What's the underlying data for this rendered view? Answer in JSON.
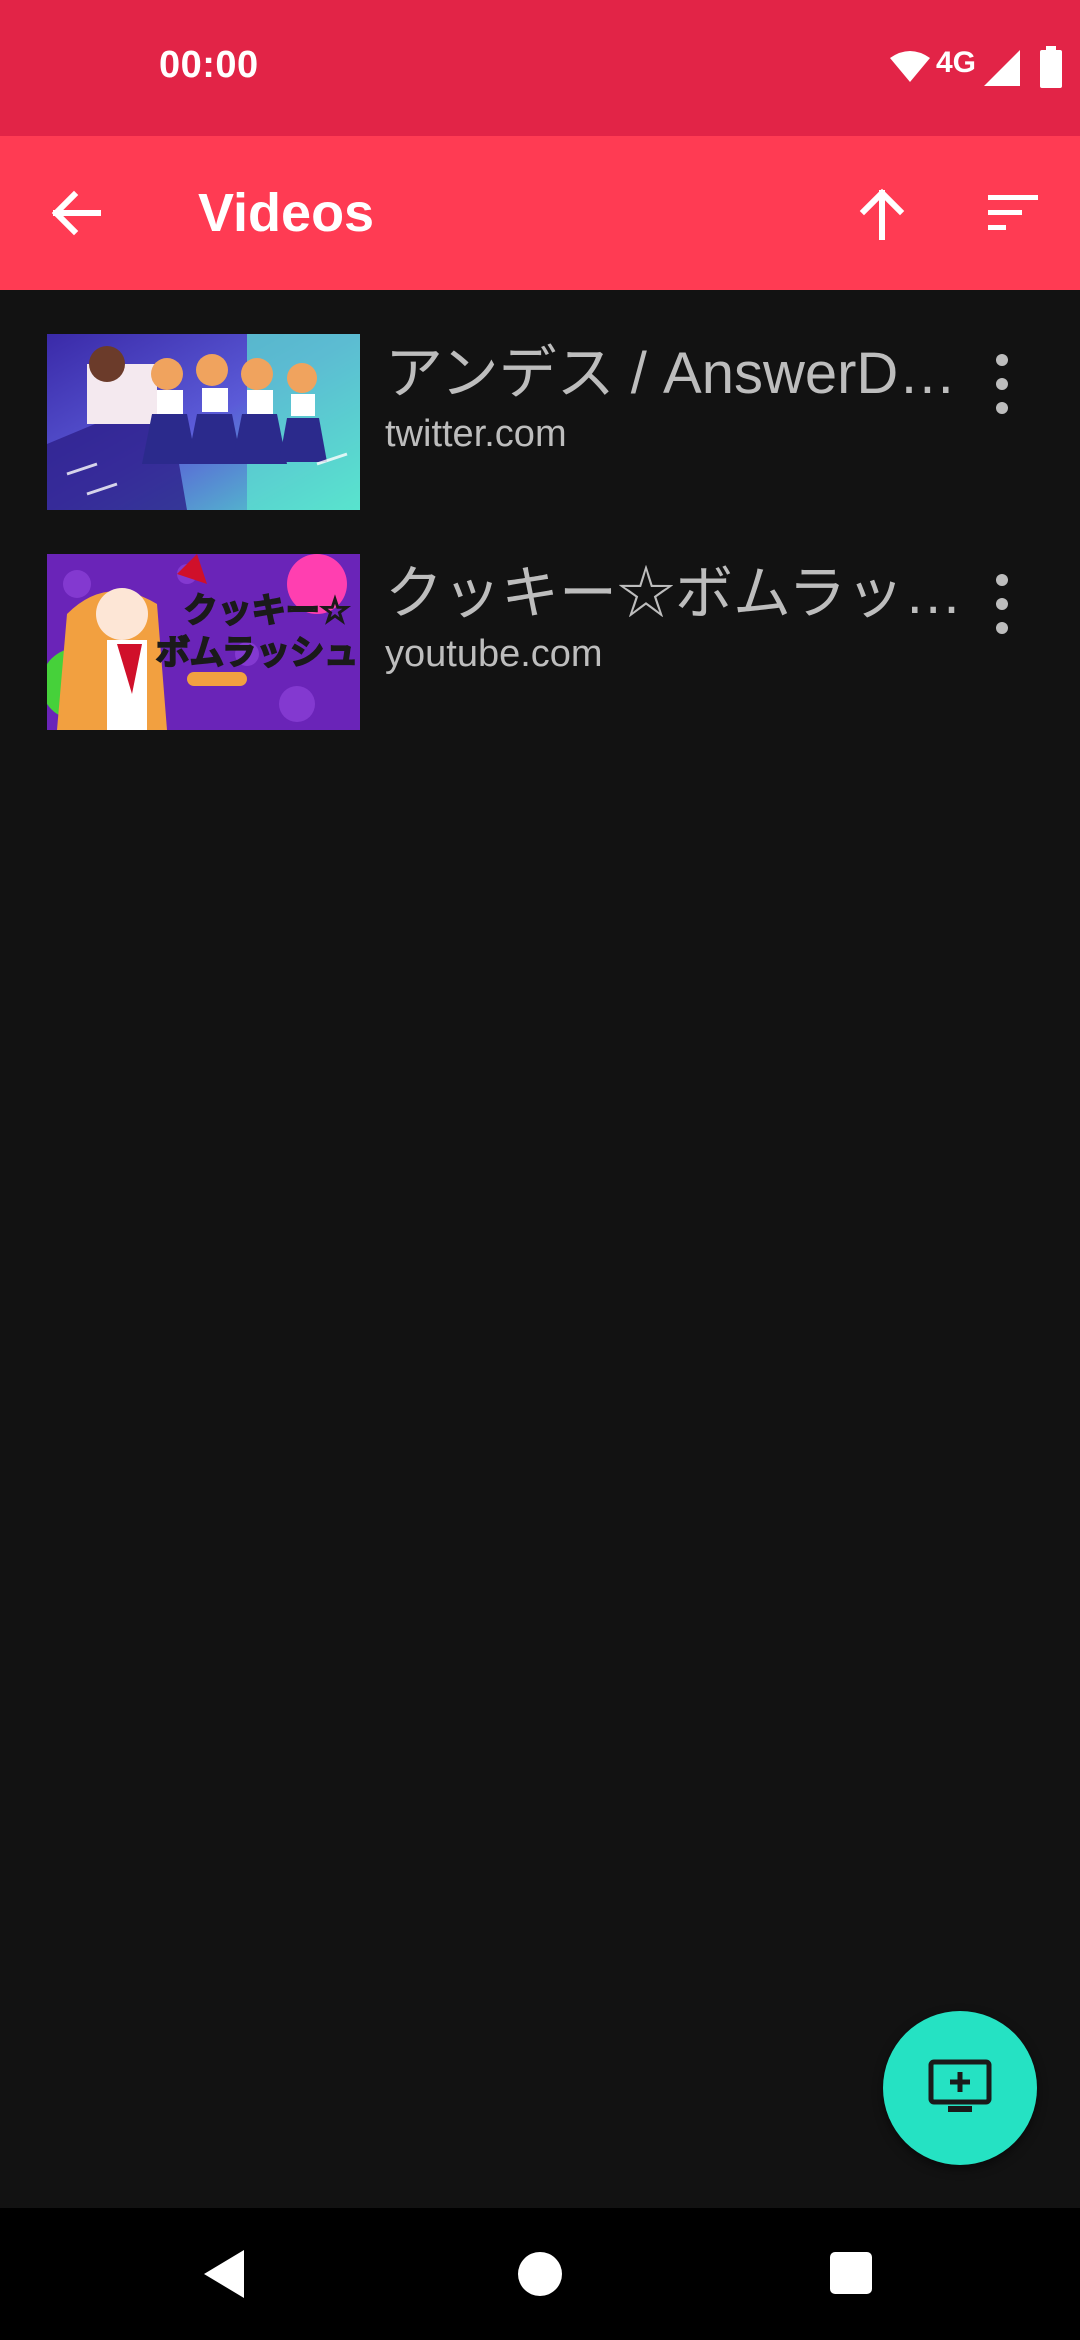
{
  "status_bar": {
    "time": "00:00",
    "network": "4G",
    "icons": [
      "wifi-icon",
      "signal-icon",
      "battery-icon"
    ]
  },
  "app_bar": {
    "title": "Videos",
    "icons": [
      "back-arrow-icon",
      "arrow-up-icon",
      "sort-icon"
    ]
  },
  "videos": [
    {
      "title": "アンデス / AnswerDes…",
      "source": "twitter.com"
    },
    {
      "title": "クッキー☆ボムラッシ…",
      "source": "youtube.com"
    }
  ],
  "thumbnails": [
    {
      "caption": ""
    },
    {
      "caption": "クッキー☆ボムラッシュ"
    }
  ],
  "fab": {
    "icon": "add-to-screen-icon"
  },
  "colors": {
    "status_bar": "#E22447",
    "app_bar": "#FF3B53",
    "background": "#121212",
    "fab": "#25E2C3",
    "text_secondary": "#BDBDBD"
  }
}
